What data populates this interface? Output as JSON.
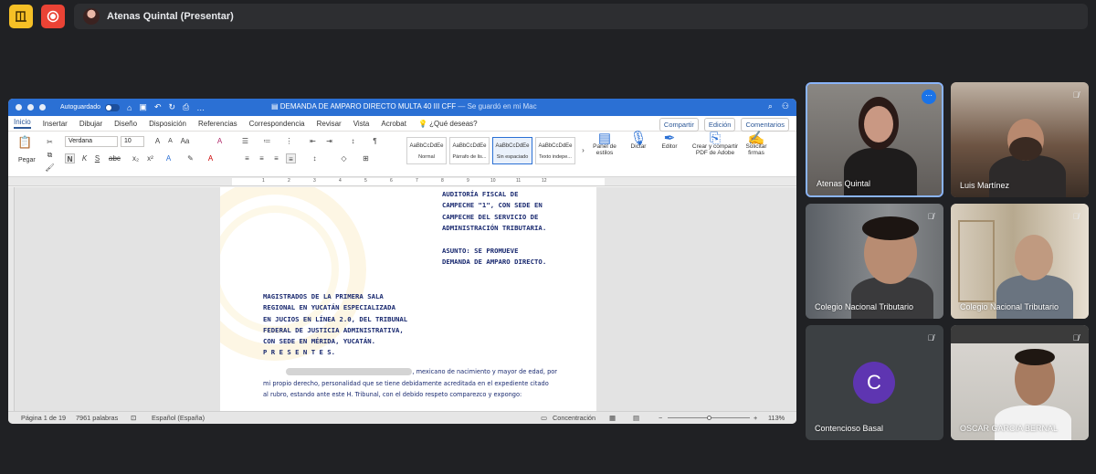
{
  "meet": {
    "presenter_label": "Atenas Quintal (Presentar)",
    "colors": {
      "info_button": "#f6c026",
      "record_button": "#ea4335",
      "active_tile_border": "#8ab4f8"
    }
  },
  "word": {
    "autosave_label": "Autoguardado",
    "doc_title": "DEMANDA DE AMPARO DIRECTO MULTA 40 III CFF",
    "save_status": "— Se guardó en mi Mac",
    "tabs": [
      "Inicio",
      "Insertar",
      "Dibujar",
      "Diseño",
      "Disposición",
      "Referencias",
      "Correspondencia",
      "Revisar",
      "Vista",
      "Acrobat",
      "¿Qué deseas?"
    ],
    "tab_actions": {
      "share": "Compartir",
      "editing": "Edición",
      "comments": "Comentarios"
    },
    "ribbon": {
      "paste": "Pegar",
      "font_name": "Verdana",
      "font_size": "10",
      "styles": [
        {
          "sample": "AaBbCcDdEe",
          "name": "Normal"
        },
        {
          "sample": "AaBbCcDdEe",
          "name": "Párrafo de lis..."
        },
        {
          "sample": "AaBbCcDdEe",
          "name": "Sin espaciado"
        },
        {
          "sample": "AaBbCcDdEe",
          "name": "Texto indepe..."
        }
      ],
      "styles_pane": "Panel de estilos",
      "dictate": "Dictar",
      "editor": "Editor",
      "create_pdf": "Crear y compartir PDF de Adobe",
      "request_signatures": "Solicitar firmas"
    },
    "ruler_numbers": [
      "1",
      "2",
      "3",
      "4",
      "5",
      "6",
      "7",
      "8",
      "9",
      "10",
      "11",
      "12"
    ],
    "document": {
      "authority_lines": [
        "AUDITORÍA FISCAL DE",
        "CAMPECHE \"1\", CON SEDE EN",
        "CAMPECHE DEL SERVICIO DE",
        "ADMINISTRACIÓN TRIBUTARIA."
      ],
      "subject_lines": [
        "ASUNTO: SE PROMUEVE",
        "DEMANDA DE AMPARO DIRECTO."
      ],
      "addressee_lines": [
        "MAGISTRADOS DE LA PRIMERA SALA",
        "REGIONAL EN YUCATÁN ESPECIALIZADA",
        "EN JUCIOS EN LÍNEA 2.0, DEL TRIBUNAL",
        "FEDERAL DE JUSTICIA ADMINISTRATIVA,",
        "CON SEDE EN MÉRIDA, YUCATÁN.",
        "P R E S E N T E S."
      ],
      "body_line1": ", mexicano de nacimiento y mayor de edad, por",
      "body_line2": "mi propio derecho, personalidad que se tiene debidamente acreditada en el expediente citado",
      "body_line3": "al rubro, estando ante este H. Tribunal, con el debido respeto comparezco y expongo:"
    },
    "status": {
      "page": "Página 1 de 19",
      "words": "7961 palabras",
      "language": "Español (España)",
      "focus": "Concentración",
      "zoom": "113%"
    }
  },
  "participants": [
    {
      "name": "Atenas Quintal",
      "active": true,
      "muted": false
    },
    {
      "name": "Luis Martínez",
      "active": false,
      "muted": true
    },
    {
      "name": "Colegio Nacional Tributario",
      "active": false,
      "muted": true
    },
    {
      "name": "Colegio Nacional Tributario",
      "active": false,
      "muted": true
    },
    {
      "name": "Contencioso Basal",
      "active": false,
      "muted": true,
      "avatar_letter": "C"
    },
    {
      "name": "OSCAR GARCIA BERNAL",
      "active": false,
      "muted": true
    }
  ]
}
